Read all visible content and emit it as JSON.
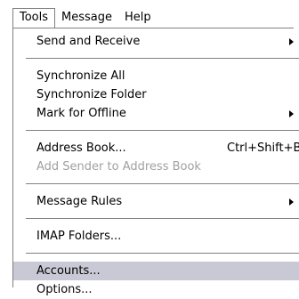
{
  "menubar": {
    "items": [
      {
        "label": "Tools"
      },
      {
        "label": "Message"
      },
      {
        "label": "Help"
      }
    ]
  },
  "menu": {
    "send_receive": {
      "label": "Send and Receive"
    },
    "synchronize_all": {
      "label": "Synchronize All"
    },
    "synchronize_folder": {
      "label": "Synchronize Folder"
    },
    "mark_offline": {
      "label": "Mark for Offline"
    },
    "address_book": {
      "label": "Address Book...",
      "shortcut": "Ctrl+Shift+B"
    },
    "add_sender": {
      "label": "Add Sender to Address Book"
    },
    "message_rules": {
      "label": "Message Rules"
    },
    "imap_folders": {
      "label": "IMAP Folders..."
    },
    "accounts": {
      "label": "Accounts..."
    },
    "options": {
      "label": "Options..."
    }
  },
  "colors": {
    "highlight": "#c9c8d5",
    "disabled_text": "#a0a0a0",
    "border": "#808080"
  }
}
